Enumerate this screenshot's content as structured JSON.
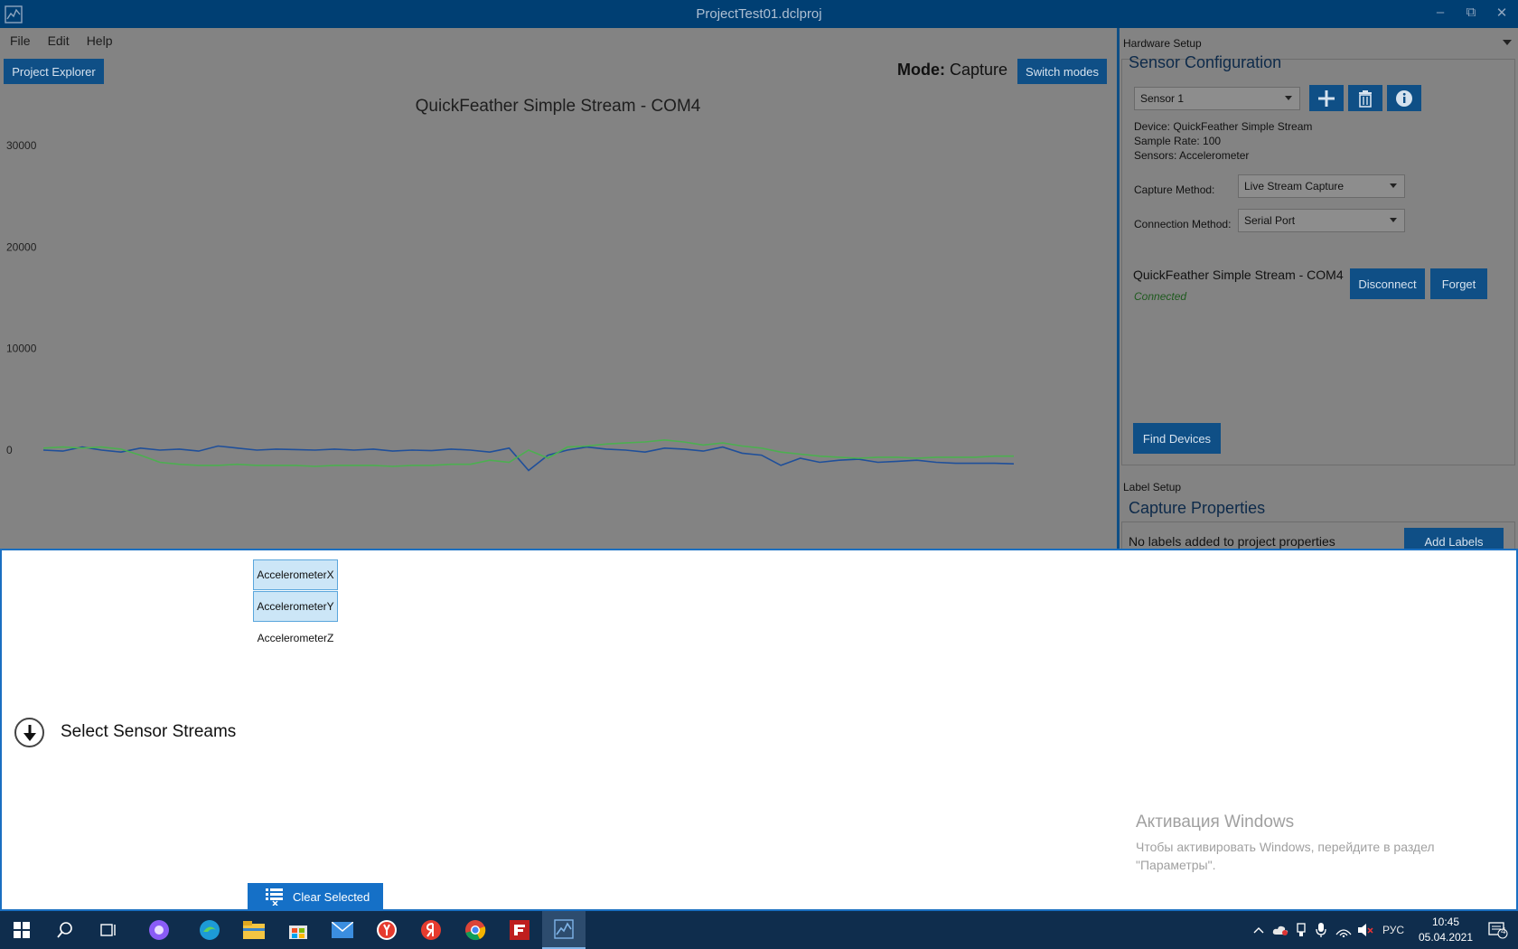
{
  "window": {
    "title": "ProjectTest01.dclproj",
    "minimize_glyph": "–",
    "restore_glyph": "⧉",
    "close_glyph": "✕"
  },
  "menu": [
    "File",
    "Edit",
    "Help"
  ],
  "toolbar": {
    "project_explorer_label": "Project Explorer",
    "mode_label": "Mode:",
    "mode_value": "Capture",
    "switch_modes_label": "Switch modes"
  },
  "chart_data": {
    "type": "line",
    "title": "QuickFeather Simple Stream - COM4",
    "xlabel": "",
    "ylabel": "",
    "yticks": [
      "30000",
      "20000",
      "10000",
      "0"
    ],
    "ylim": [
      -5500,
      34500
    ],
    "grid": false,
    "series": [
      {
        "color": "#1f4f9a",
        "values": [
          0,
          -100,
          300,
          0,
          -200,
          200,
          0,
          100,
          -100,
          400,
          200,
          0,
          100,
          50,
          0,
          100,
          0,
          100,
          -100,
          0,
          -50,
          100,
          0,
          -200,
          200,
          -2000,
          -500,
          0,
          300,
          100,
          0,
          -200,
          200,
          100,
          -100,
          300,
          -300,
          -500,
          -1500,
          -800,
          -1200,
          -1000,
          -900,
          -1200,
          -1100,
          -1000,
          -1200,
          -1300,
          -1300,
          -1300,
          -1350
        ]
      },
      {
        "color": "#4caf50",
        "values": [
          200,
          300,
          200,
          300,
          100,
          -500,
          -1200,
          -1400,
          -1500,
          -1500,
          -1400,
          -1500,
          -1500,
          -1500,
          -1600,
          -1500,
          -1500,
          -1500,
          -1600,
          -1500,
          -1500,
          -1400,
          -1400,
          -1000,
          -1200,
          0,
          -800,
          300,
          400,
          600,
          700,
          800,
          1000,
          800,
          500,
          700,
          400,
          200,
          -200,
          -400,
          -600,
          -700,
          -800,
          -700,
          -700,
          -800,
          -700,
          -700,
          -700,
          -600,
          -600
        ]
      }
    ]
  },
  "right_panel": {
    "hardware_header": "Hardware Setup",
    "sensor_config_title": "Sensor Configuration",
    "sensor_select_value": "Sensor 1",
    "device_line": "Device: QuickFeather Simple Stream",
    "sample_rate_line": "Sample Rate: 100",
    "sensors_line": "Sensors: Accelerometer",
    "capture_method_label": "Capture Method:",
    "capture_method_value": "Live Stream Capture",
    "connection_method_label": "Connection Method:",
    "connection_method_value": "Serial Port",
    "device_name": "QuickFeather Simple Stream - COM4",
    "device_status": "Connected",
    "disconnect_label": "Disconnect",
    "forget_label": "Forget",
    "find_devices_label": "Find Devices",
    "label_setup_header": "Label Setup",
    "capture_properties_title": "Capture Properties",
    "no_labels_text": "No labels added to project properties",
    "add_labels_label": "Add Labels"
  },
  "sensor_streams": {
    "items": [
      {
        "label": "AccelerometerX",
        "selected": true
      },
      {
        "label": "AccelerometerY",
        "selected": true
      },
      {
        "label": "AccelerometerZ",
        "selected": false
      }
    ],
    "step_label": "Select Sensor Streams",
    "clear_selected_label": "Clear Selected"
  },
  "activation": {
    "title": "Активация Windows",
    "line1": "Чтобы активировать Windows, перейдите в раздел",
    "line2": "\"Параметры\"."
  },
  "taskbar": {
    "language": "РУС",
    "time": "10:45",
    "date": "05.04.2021",
    "notification_count": "4"
  }
}
